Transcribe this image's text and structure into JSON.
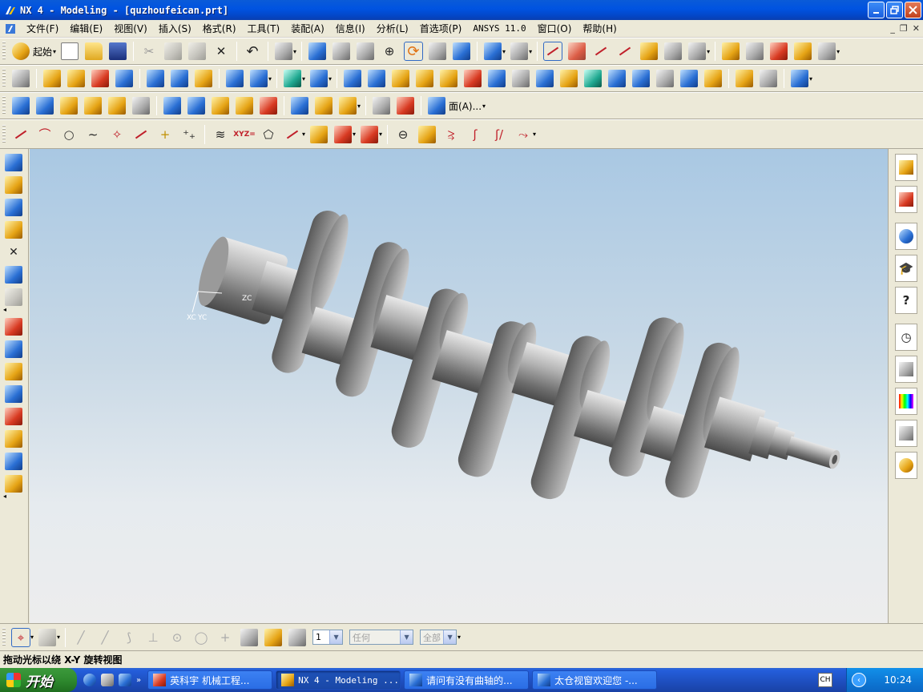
{
  "window": {
    "title": "NX 4 - Modeling - [quzhoufeican.prt]"
  },
  "menubar": {
    "items": [
      "文件(F)",
      "编辑(E)",
      "视图(V)",
      "插入(S)",
      "格式(R)",
      "工具(T)",
      "装配(A)",
      "信息(I)",
      "分析(L)",
      "首选项(P)",
      "ANSYS 11.0",
      "窗口(O)",
      "帮助(H)"
    ]
  },
  "toolbar1": {
    "start_label": "起始"
  },
  "toolbar3": {
    "face_label": "面(A)..."
  },
  "toolbar4": {
    "xyz_label": "XYZ="
  },
  "viewport": {
    "triad_x_label": "XC",
    "triad_y_label": "YC",
    "triad_z_label": "ZC"
  },
  "selection": {
    "layer_value": "1",
    "filter_value": "任何",
    "scope_value": "全部"
  },
  "status": {
    "message": "拖动光标以绕 X-Y 旋转视图"
  },
  "taskbar": {
    "start_label": "开始",
    "tasks": [
      "英科宇 机械工程...",
      "NX 4 - Modeling ...",
      "请问有没有曲轴的...",
      "太仓视窗欢迎您 -..."
    ],
    "ime_label": "CH",
    "clock": "10:24"
  }
}
